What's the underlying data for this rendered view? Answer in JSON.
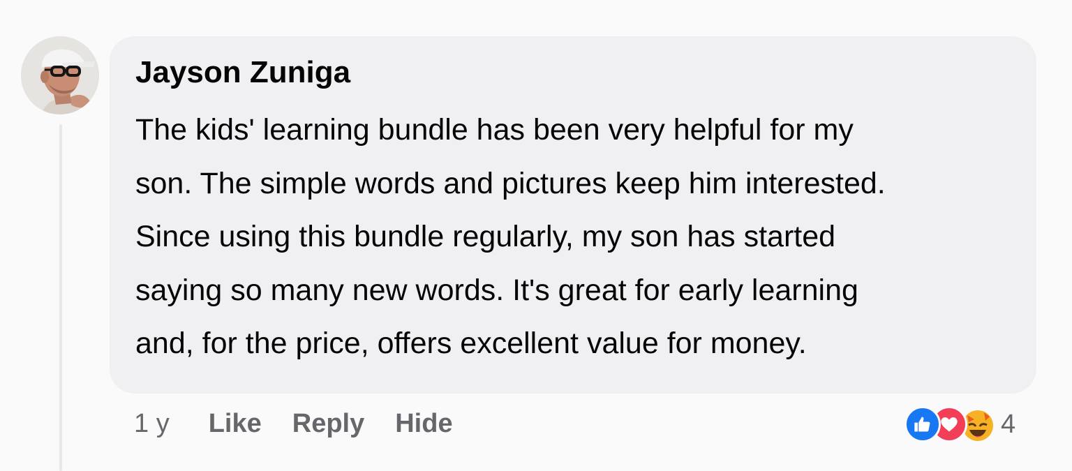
{
  "comment": {
    "author": "Jayson Zuniga",
    "body_lines": [
      "The kids' learning bundle has been very helpful for my",
      "son. The simple words and pictures keep him interested.",
      "Since using this bundle regularly, my son has started",
      "saying so many new words. It's great for early learning",
      "and, for the price, offers excellent value for money."
    ],
    "timestamp": "1 y",
    "actions": {
      "like_label": "Like",
      "reply_label": "Reply",
      "hide_label": "Hide"
    },
    "reactions": {
      "types": [
        "like-icon",
        "love-icon",
        "haha-icon"
      ],
      "count": "4"
    }
  },
  "colors": {
    "background": "#fafafb",
    "bubble": "#f0f0f3",
    "text": "#050505",
    "secondary_text": "#65676b",
    "like_blue": "#1877f2",
    "love_red": "#f33e58"
  }
}
